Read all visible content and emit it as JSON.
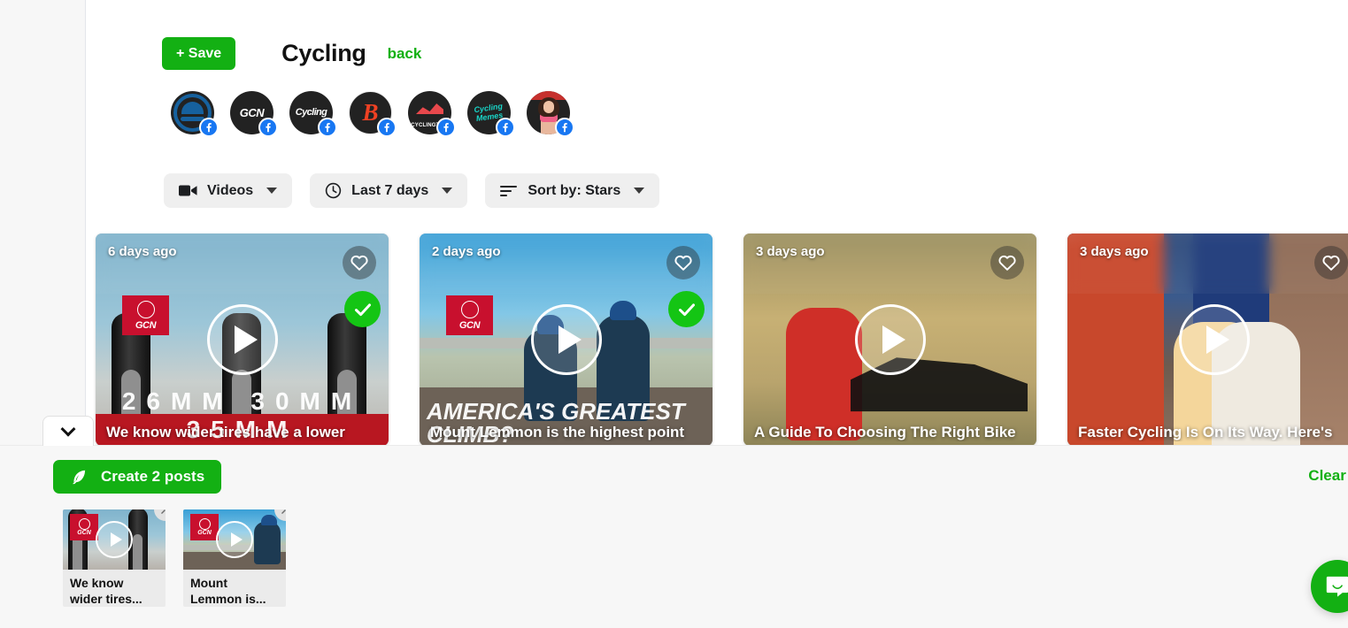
{
  "header": {
    "save_label": "+ Save",
    "title": "Cycling",
    "back_label": "back"
  },
  "sources": [
    {
      "name": "bikeradar",
      "label": "",
      "network": "facebook"
    },
    {
      "name": "gcn",
      "label": "GCN",
      "network": "facebook"
    },
    {
      "name": "cycling-weekly",
      "label": "Cycling",
      "network": "facebook"
    },
    {
      "name": "bicycling",
      "label": "B",
      "network": "facebook"
    },
    {
      "name": "cyclingtips",
      "label": "CYCLINGTIPS",
      "network": "facebook"
    },
    {
      "name": "cycling-memes",
      "label": "Cycling Memes",
      "network": "facebook"
    },
    {
      "name": "health-fitness",
      "label": "",
      "network": "facebook"
    }
  ],
  "filters": [
    {
      "icon": "video-camera-icon",
      "label": "Videos"
    },
    {
      "icon": "clock-icon",
      "label": "Last 7 days"
    },
    {
      "icon": "sort-icon",
      "label": "Sort by: Stars"
    }
  ],
  "cards": [
    {
      "age": "6 days ago",
      "caption": "We know wider tires have a lower",
      "selected": true,
      "has_channel_badge": true,
      "channel_badge": "GCN",
      "overlay_text": "26MM 30MM 35MM"
    },
    {
      "age": "2 days ago",
      "caption": "Mount Lemmon is the highest point",
      "selected": true,
      "has_channel_badge": true,
      "channel_badge": "GCN",
      "overlay_text": "AMERICA'S GREATEST CLIMB?"
    },
    {
      "age": "3 days ago",
      "caption": "A Guide To Choosing The Right Bike",
      "selected": false,
      "has_channel_badge": false,
      "channel_badge": "",
      "overlay_text": ""
    },
    {
      "age": "3 days ago",
      "caption": "Faster Cycling Is On Its Way. Here's",
      "selected": false,
      "has_channel_badge": false,
      "channel_badge": "",
      "overlay_text": ""
    }
  ],
  "drawer": {
    "create_label": "Create 2 posts",
    "clear_label": "Clear a",
    "items": [
      {
        "channel_badge": "GCN",
        "caption": "We know wider tires..."
      },
      {
        "channel_badge": "GCN",
        "caption": "Mount Lemmon is..."
      }
    ]
  },
  "colors": {
    "brand_green": "#13b013",
    "facebook_blue": "#1877f2",
    "banner_purple": "#f2e2f3",
    "gcn_red": "#c8102e"
  }
}
